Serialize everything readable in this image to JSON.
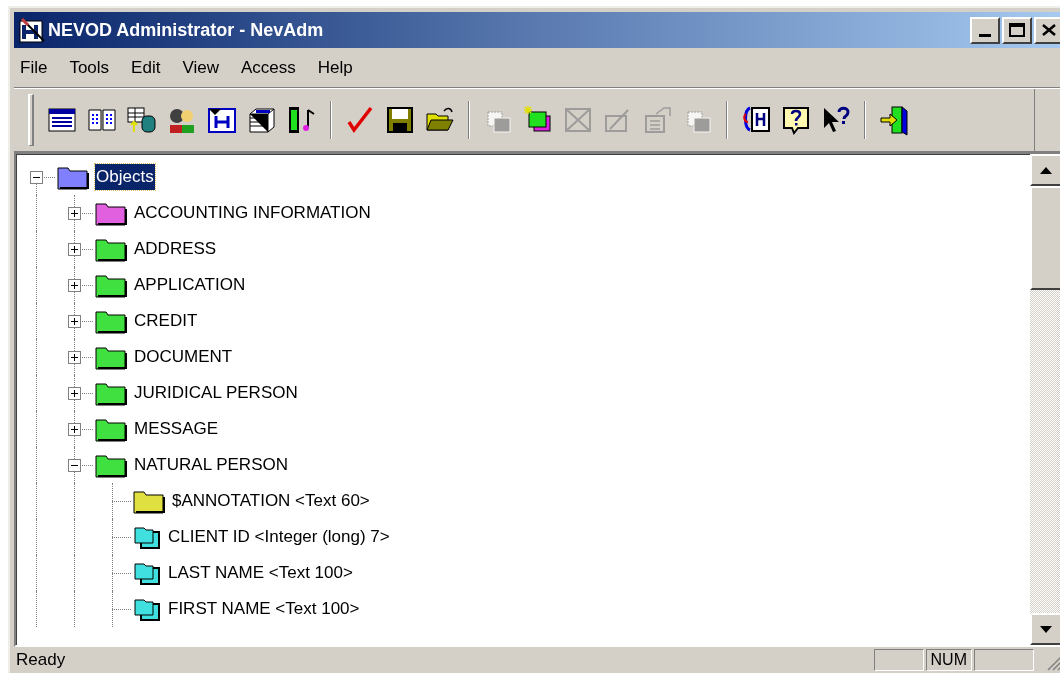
{
  "window": {
    "title": "NEVOD Administrator - NevAdm"
  },
  "menu": [
    "File",
    "Tools",
    "Edit",
    "View",
    "Access",
    "Help"
  ],
  "toolbar": [
    [
      {
        "kind": "list",
        "disabled": false
      },
      {
        "kind": "book",
        "disabled": false
      },
      {
        "kind": "table-db",
        "disabled": false
      },
      {
        "kind": "people",
        "disabled": false
      },
      {
        "kind": "window-h",
        "disabled": false
      },
      {
        "kind": "stack",
        "disabled": false
      },
      {
        "kind": "film-note",
        "disabled": false
      }
    ],
    [
      {
        "kind": "check",
        "disabled": false
      },
      {
        "kind": "save",
        "disabled": false
      },
      {
        "kind": "open",
        "disabled": false
      }
    ],
    [
      {
        "kind": "copy",
        "disabled": true
      },
      {
        "kind": "new",
        "disabled": false
      },
      {
        "kind": "delete",
        "disabled": true
      },
      {
        "kind": "edit",
        "disabled": true
      },
      {
        "kind": "properties",
        "disabled": true
      },
      {
        "kind": "copy",
        "disabled": true
      }
    ],
    [
      {
        "kind": "help-h",
        "disabled": false
      },
      {
        "kind": "help-q",
        "disabled": false
      },
      {
        "kind": "whats-this",
        "disabled": false
      }
    ],
    [
      {
        "kind": "exit",
        "disabled": false
      }
    ]
  ],
  "tree": [
    {
      "label": "Objects",
      "kind": "folder",
      "color": "#8080ff",
      "expanded": true,
      "selected": true,
      "children": [
        {
          "label": "ACCOUNTING INFORMATION",
          "kind": "folder",
          "color": "#e060e0",
          "expanded": false,
          "selected": false
        },
        {
          "label": "ADDRESS",
          "kind": "folder",
          "color": "#40e040",
          "expanded": false,
          "selected": false
        },
        {
          "label": "APPLICATION",
          "kind": "folder",
          "color": "#40e040",
          "expanded": false,
          "selected": false
        },
        {
          "label": "CREDIT",
          "kind": "folder",
          "color": "#40e040",
          "expanded": false,
          "selected": false
        },
        {
          "label": "DOCUMENT",
          "kind": "folder",
          "color": "#40e040",
          "expanded": false,
          "selected": false
        },
        {
          "label": "JURIDICAL PERSON",
          "kind": "folder",
          "color": "#40e040",
          "expanded": false,
          "selected": false
        },
        {
          "label": "MESSAGE",
          "kind": "folder",
          "color": "#40e040",
          "expanded": false,
          "selected": false
        },
        {
          "label": "NATURAL PERSON",
          "kind": "folder",
          "color": "#40e040",
          "expanded": true,
          "selected": false,
          "children": [
            {
              "label": "$ANNOTATION <Text 60>",
              "kind": "folder",
              "color": "#e0e040",
              "selected": false
            },
            {
              "label": "CLIENT ID <Integer (long) 7>",
              "kind": "field",
              "color": "#40e0e0",
              "selected": false
            },
            {
              "label": "LAST NAME <Text 100>",
              "kind": "field",
              "color": "#40e0e0",
              "selected": false
            },
            {
              "label": "FIRST NAME <Text 100>",
              "kind": "field",
              "color": "#40e0e0",
              "selected": false
            }
          ]
        }
      ]
    }
  ],
  "status_bar": {
    "message": "Ready",
    "indicators": [
      "NUM"
    ]
  }
}
